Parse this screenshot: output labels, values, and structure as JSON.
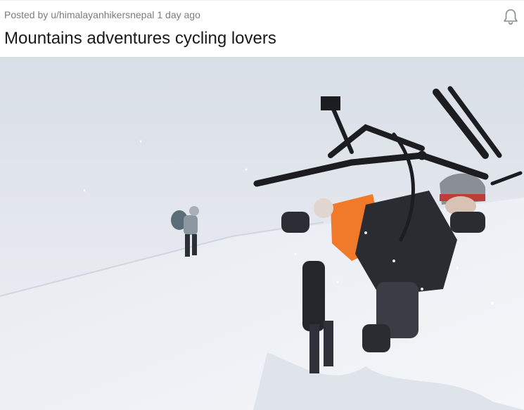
{
  "post": {
    "posted_by_prefix": "Posted by",
    "author": "u/himalayanhikersnepal",
    "time_ago": "1 day ago",
    "title": "Mountains adventures cycling lovers"
  },
  "icons": {
    "notification": "bell-icon"
  },
  "colors": {
    "meta_text": "#7c7c7c",
    "title_text": "#1a1a1b",
    "snow": "#e9ecf1",
    "bag_orange": "#f07a2a"
  }
}
